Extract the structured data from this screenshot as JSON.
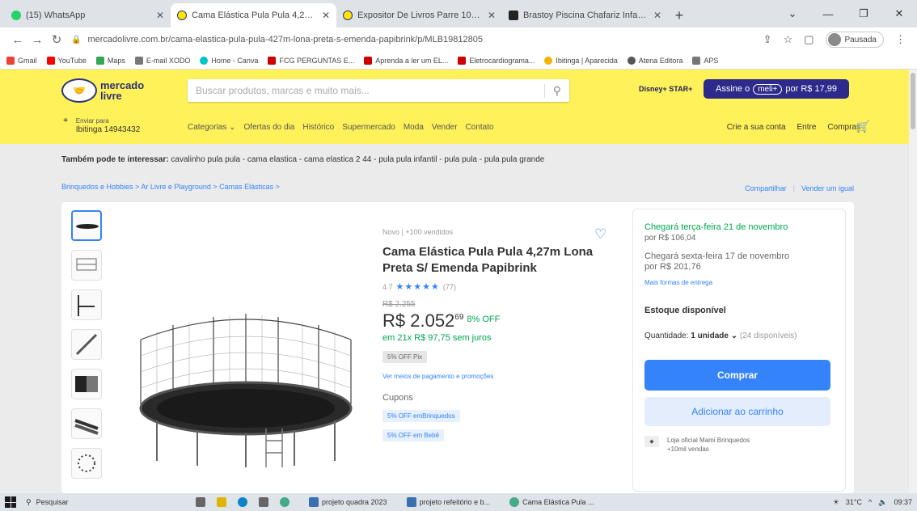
{
  "browser": {
    "tabs": [
      {
        "label": "(15) WhatsApp",
        "color": "#25d366"
      },
      {
        "label": "Cama Elástica Pula Pula 4,27m ...",
        "color": "#ffe600"
      },
      {
        "label": "Expositor De Livros Parre 100% ...",
        "color": "#ffe600"
      },
      {
        "label": "Brastoy Piscina Chafariz Infantil ...",
        "color": "#222222"
      }
    ],
    "url": "mercadolivre.com.br/cama-elastica-pula-pula-427m-lona-preta-s-emenda-papibrink/p/MLB19812805",
    "profile_label": "Pausada",
    "bookmarks": [
      {
        "label": "Gmail",
        "color": "#ea4335"
      },
      {
        "label": "YouTube",
        "color": "#ff0000"
      },
      {
        "label": "Maps",
        "color": "#34a853"
      },
      {
        "label": "E-mail XODO",
        "color": "#777777"
      },
      {
        "label": "Home - Canva",
        "color": "#00c4cc"
      },
      {
        "label": "FCG PERGUNTAS E...",
        "color": "#cc0000"
      },
      {
        "label": "Aprenda a ler um EL...",
        "color": "#cc0000"
      },
      {
        "label": "Eletrocardiograma...",
        "color": "#cc0000"
      },
      {
        "label": "Ibitinga | Aparecida",
        "color": "#f4b400"
      },
      {
        "label": "Atena Editora",
        "color": "#555555"
      },
      {
        "label": "APS",
        "color": "#777777"
      }
    ]
  },
  "ml": {
    "logo_line1": "mercado",
    "logo_line2": "livre",
    "search_placeholder": "Buscar produtos, marcas e muito mais...",
    "disney": "Disney+ STAR+",
    "assine_text": "Assine o",
    "assine_plus": "meli+",
    "assine_price": "por R$ 17,99",
    "address_small": "Enviar para",
    "address_main": "Ibitinga 14943432",
    "nav": [
      "Categorias ⌄",
      "Ofertas do dia",
      "Histórico",
      "Supermercado",
      "Moda",
      "Vender",
      "Contato"
    ],
    "account": [
      "Crie a sua conta",
      "Entre",
      "Compras"
    ]
  },
  "page": {
    "interest_label": "Também pode te interessar:",
    "interest_items": "cavalinho pula pula - cama elastica - cama elastica 2 44 - pula pula infantil - pula pula - pula pula grande",
    "breadcrumb": "Brinquedos e Hobbies > Ar Livre e Playground > Camas Elásticas >",
    "share": "Compartilhar",
    "sell_same": "Vender um igual"
  },
  "product": {
    "condition": "Novo | +100 vendidos",
    "title": "Cama Elástica Pula Pula 4,27m Lona Preta S/ Emenda Papibrink",
    "rating_value": "4.7",
    "stars": "★★★★★",
    "rating_count": "(77)",
    "old_price": "R$ 2.255",
    "price_main": "R$ 2.052",
    "price_cents": "69",
    "discount": "8% OFF",
    "installments": "em 21x R$ 97,75 sem juros",
    "pix_badge": "5% OFF Pix",
    "payment_link": "Ver meios de pagamento e promoções",
    "coupons_label": "Cupons",
    "coupons": [
      "5% OFF emBrinquedos",
      "5% OFF em Bebê"
    ]
  },
  "buybox": {
    "ship1_line1": "Chegará terça-feira 21 de novembro",
    "ship1_price": "por R$ 106,04",
    "ship2_line1": "Chegará sexta-feira 17 de novembro",
    "ship2_price": "por R$ 201,76",
    "more_shipping": "Mais formas de entrega",
    "stock": "Estoque disponível",
    "qty_label": "Quantidade:",
    "qty_value": "1 unidade ⌄",
    "qty_available": "(24 disponíveis)",
    "buy": "Comprar",
    "add_cart": "Adicionar ao carrinho",
    "seller_line1": "Loja oficial Mami Brinquedos",
    "seller_line2": "+10mil vendas"
  },
  "taskbar": {
    "search": "Pesquisar",
    "windows": [
      "projeto quadra 2023",
      "projeto refeitório e b...",
      "Cama Elástica Pula ..."
    ],
    "weather": "31°C",
    "time": "09:37"
  }
}
